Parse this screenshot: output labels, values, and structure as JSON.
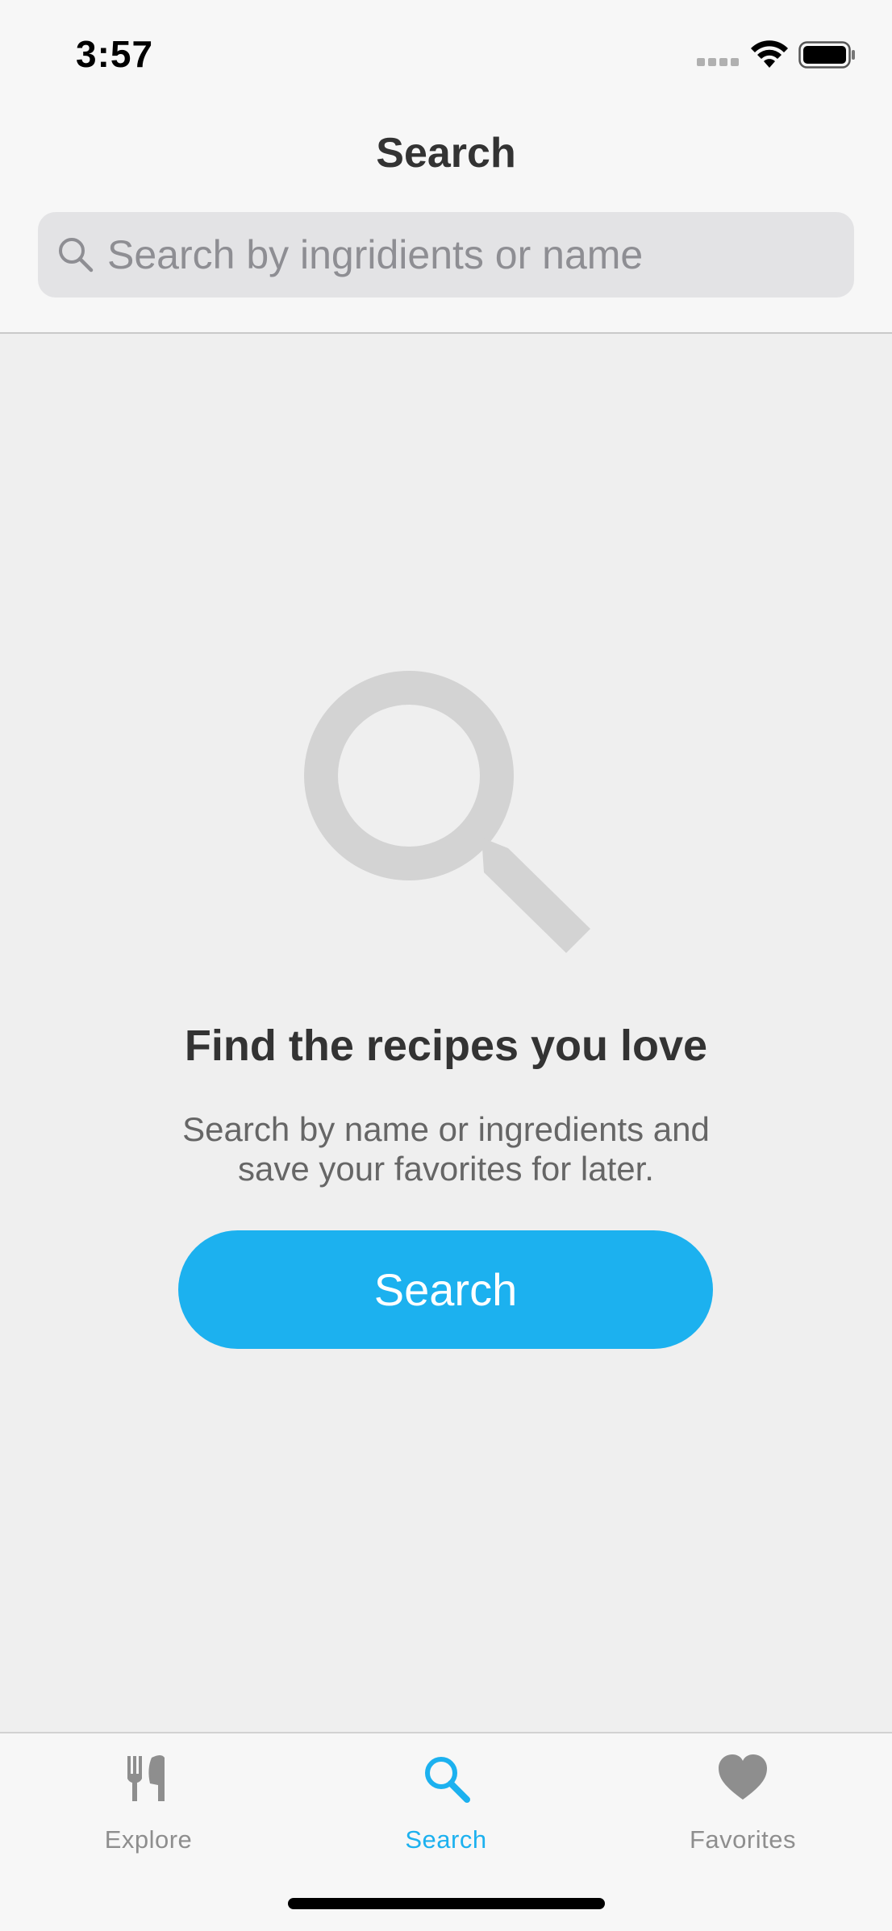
{
  "status_bar": {
    "time": "3:57"
  },
  "header": {
    "title": "Search"
  },
  "search": {
    "placeholder": "Search by ingridients or name",
    "value": ""
  },
  "empty_state": {
    "icon": "magnifier-icon",
    "title": "Find the recipes you love",
    "subtitle_line1": "Search by name or ingredients and",
    "subtitle_line2": "save your favorites for later.",
    "button_label": "Search"
  },
  "tab_bar": {
    "active": "Search",
    "items": [
      {
        "label": "Explore",
        "icon": "utensils-icon"
      },
      {
        "label": "Search",
        "icon": "search-icon"
      },
      {
        "label": "Favorites",
        "icon": "heart-icon"
      }
    ]
  },
  "colors": {
    "accent": "#1cb1ef",
    "inactive_tab": "#8e8e8e",
    "background": "#efefef",
    "bar_background": "#f7f7f7"
  }
}
